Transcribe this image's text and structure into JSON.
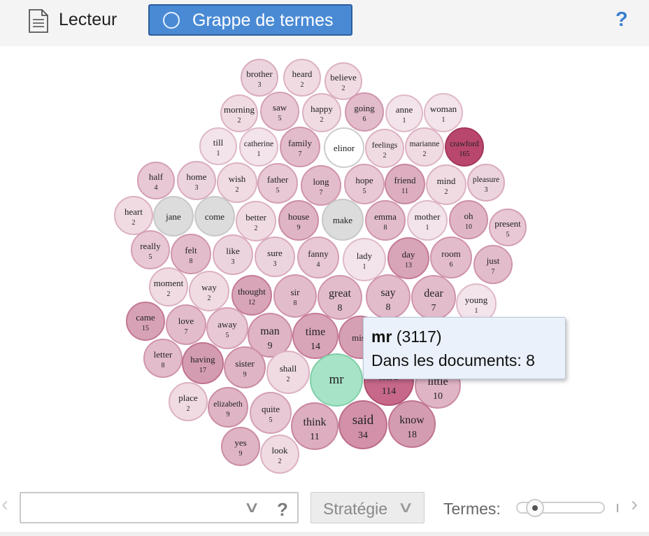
{
  "toolbar": {
    "reader_label": "Lecteur",
    "cluster_label": "Grappe de termes",
    "help_label": "?"
  },
  "tooltip": {
    "term": "mr",
    "count": "(3117)",
    "docs_label": "Dans les documents: 8"
  },
  "bottom": {
    "search_value": "",
    "help_label": "?",
    "strategy_label": "Stratégie",
    "terms_label": "Termes:",
    "terms_slider_fraction": 0.15
  },
  "colors": {
    "accent": "#4a8ad5",
    "bubble_light": "#efd9e2",
    "bubble_dark": "#b8466d",
    "highlight": "#a7e3c7",
    "gray": "#dcdcdc"
  },
  "bubbles": [
    {
      "term": "brother",
      "count": "3"
    },
    {
      "term": "heard",
      "count": "2"
    },
    {
      "term": "believe",
      "count": "2"
    },
    {
      "term": "morning",
      "count": "2"
    },
    {
      "term": "saw",
      "count": "5"
    },
    {
      "term": "happy",
      "count": "2"
    },
    {
      "term": "going",
      "count": "6"
    },
    {
      "term": "anne",
      "count": "1"
    },
    {
      "term": "woman",
      "count": "1"
    },
    {
      "term": "till",
      "count": "1"
    },
    {
      "term": "catherine",
      "count": "1"
    },
    {
      "term": "family",
      "count": "7"
    },
    {
      "term": "elinor",
      "count": ""
    },
    {
      "term": "feelings",
      "count": "2"
    },
    {
      "term": "marianne",
      "count": "2"
    },
    {
      "term": "crawford",
      "count": "165"
    },
    {
      "term": "half",
      "count": "4"
    },
    {
      "term": "home",
      "count": "3"
    },
    {
      "term": "wish",
      "count": "2"
    },
    {
      "term": "father",
      "count": "5"
    },
    {
      "term": "long",
      "count": "7"
    },
    {
      "term": "hope",
      "count": "5"
    },
    {
      "term": "friend",
      "count": "11"
    },
    {
      "term": "mind",
      "count": "2"
    },
    {
      "term": "pleasure",
      "count": "3"
    },
    {
      "term": "heart",
      "count": "2"
    },
    {
      "term": "jane",
      "count": ""
    },
    {
      "term": "come",
      "count": ""
    },
    {
      "term": "better",
      "count": "2"
    },
    {
      "term": "house",
      "count": "9"
    },
    {
      "term": "make",
      "count": ""
    },
    {
      "term": "emma",
      "count": "8"
    },
    {
      "term": "mother",
      "count": "1"
    },
    {
      "term": "oh",
      "count": "10"
    },
    {
      "term": "present",
      "count": "5"
    },
    {
      "term": "really",
      "count": "5"
    },
    {
      "term": "felt",
      "count": "8"
    },
    {
      "term": "like",
      "count": "3"
    },
    {
      "term": "sure",
      "count": "3"
    },
    {
      "term": "fanny",
      "count": "4"
    },
    {
      "term": "lady",
      "count": "1"
    },
    {
      "term": "day",
      "count": "13"
    },
    {
      "term": "room",
      "count": "6"
    },
    {
      "term": "just",
      "count": "7"
    },
    {
      "term": "moment",
      "count": "2"
    },
    {
      "term": "way",
      "count": "2"
    },
    {
      "term": "thought",
      "count": "12"
    },
    {
      "term": "sir",
      "count": "8"
    },
    {
      "term": "great",
      "count": "8"
    },
    {
      "term": "say",
      "count": "8"
    },
    {
      "term": "dear",
      "count": "7"
    },
    {
      "term": "young",
      "count": "1"
    },
    {
      "term": "came",
      "count": "15"
    },
    {
      "term": "love",
      "count": "7"
    },
    {
      "term": "away",
      "count": "5"
    },
    {
      "term": "man",
      "count": "9"
    },
    {
      "term": "time",
      "count": "14"
    },
    {
      "term": "miss",
      "count": ""
    },
    {
      "term": "letter",
      "count": "8"
    },
    {
      "term": "having",
      "count": "17"
    },
    {
      "term": "sister",
      "count": "9"
    },
    {
      "term": "shall",
      "count": "2"
    },
    {
      "term": "mr",
      "count": ""
    },
    {
      "term": "mrs",
      "count": "114"
    },
    {
      "term": "little",
      "count": "10"
    },
    {
      "term": "place",
      "count": "2"
    },
    {
      "term": "elizabeth",
      "count": "9"
    },
    {
      "term": "quite",
      "count": "5"
    },
    {
      "term": "think",
      "count": "11"
    },
    {
      "term": "said",
      "count": "34"
    },
    {
      "term": "know",
      "count": "18"
    },
    {
      "term": "yes",
      "count": "9"
    },
    {
      "term": "look",
      "count": "2"
    }
  ]
}
